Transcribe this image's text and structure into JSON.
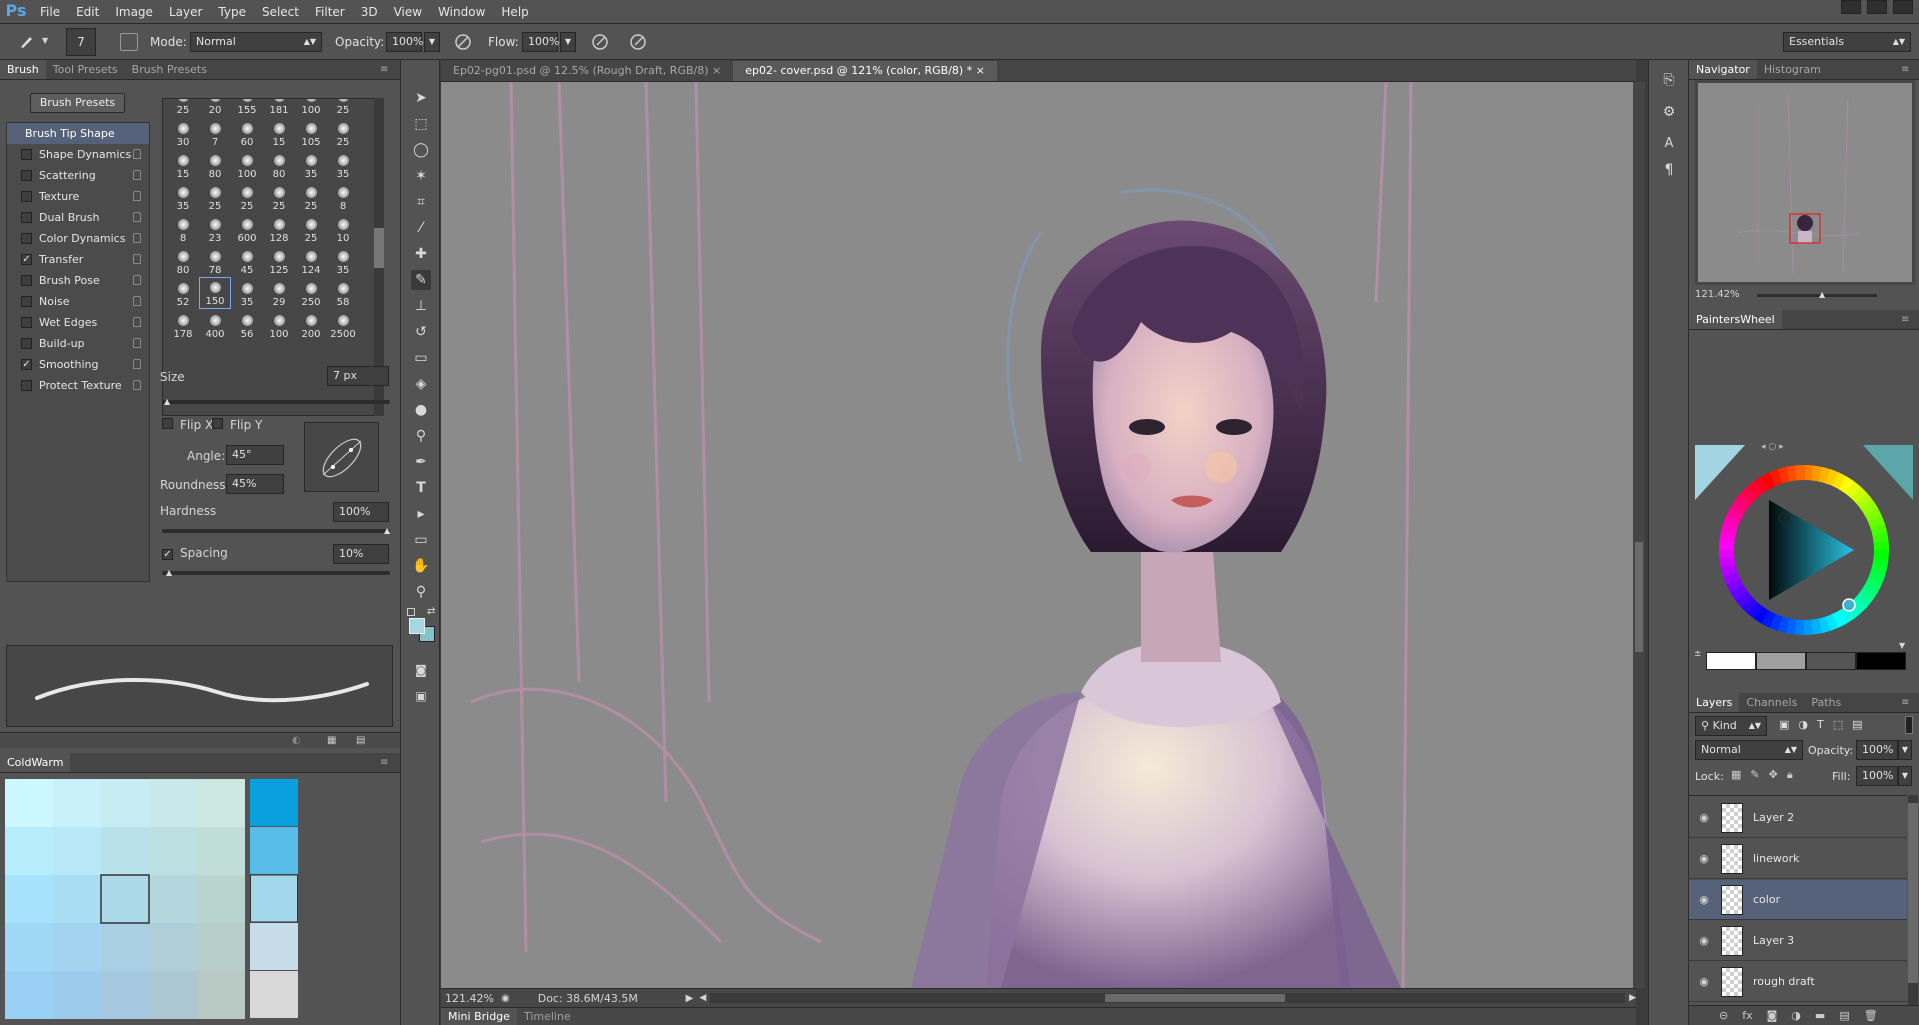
{
  "app": {
    "logo": "Ps"
  },
  "menu": [
    "File",
    "Edit",
    "Image",
    "Layer",
    "Type",
    "Select",
    "Filter",
    "3D",
    "View",
    "Window",
    "Help"
  ],
  "options": {
    "brush_size": "7",
    "mode_label": "Mode:",
    "mode_value": "Normal",
    "opacity_label": "Opacity:",
    "opacity_value": "100%",
    "flow_label": "Flow:",
    "flow_value": "100%",
    "workspace": "Essentials"
  },
  "brush_panel": {
    "tabs": [
      "Brush",
      "Tool Presets",
      "Brush Presets"
    ],
    "presets_button": "Brush Presets",
    "tip_shape": "Brush Tip Shape",
    "settings": [
      {
        "label": "Shape Dynamics",
        "checked": false
      },
      {
        "label": "Scattering",
        "checked": false
      },
      {
        "label": "Texture",
        "checked": false
      },
      {
        "label": "Dual Brush",
        "checked": false
      },
      {
        "label": "Color Dynamics",
        "checked": false
      },
      {
        "label": "Transfer",
        "checked": true
      },
      {
        "label": "Brush Pose",
        "checked": false
      },
      {
        "label": "Noise",
        "checked": false
      },
      {
        "label": "Wet Edges",
        "checked": false
      },
      {
        "label": "Build-up",
        "checked": false
      },
      {
        "label": "Smoothing",
        "checked": true
      },
      {
        "label": "Protect Texture",
        "checked": false
      }
    ],
    "brush_sizes": [
      "25",
      "20",
      "155",
      "181",
      "100",
      "25",
      "30",
      "7",
      "60",
      "15",
      "105",
      "25",
      "15",
      "80",
      "100",
      "80",
      "35",
      "35",
      "35",
      "25",
      "25",
      "25",
      "25",
      "8",
      "8",
      "23",
      "600",
      "128",
      "25",
      "10",
      "80",
      "78",
      "45",
      "125",
      "124",
      "35",
      "52",
      "150",
      "35",
      "29",
      "250",
      "58",
      "178",
      "400",
      "56",
      "100",
      "200",
      "2500"
    ],
    "size_label": "Size",
    "size_value": "7 px",
    "flipx": "Flip X",
    "flipy": "Flip Y",
    "angle_label": "Angle:",
    "angle_value": "45°",
    "roundness_label": "Roundness:",
    "roundness_value": "45%",
    "hardness_label": "Hardness",
    "hardness_value": "100%",
    "spacing_label": "Spacing",
    "spacing_value": "10%"
  },
  "coldwarm": {
    "title": "ColdWarm",
    "grid_colors": [
      [
        "#ccf7ff",
        "#c9f1fb",
        "#c8ecf4",
        "#c8e9ea",
        "#cce6e0"
      ],
      [
        "#b7ecfd",
        "#b8e7f7",
        "#b8e1ec",
        "#bcdfe2",
        "#c1ddd7"
      ],
      [
        "#a6e2fb",
        "#a9ddf4",
        "#acd9e8",
        "#b3d7dc",
        "#b9d4cf"
      ],
      [
        "#9fd8f7",
        "#a3d3ef",
        "#a8cfe3",
        "#afced7",
        "#b7cdca"
      ],
      [
        "#98cff2",
        "#9dcbeb",
        "#a4c8df",
        "#adc7d2",
        "#b8c8c2"
      ]
    ],
    "column_colors": [
      "#0aa0e0",
      "#58bde9",
      "#a2d7ec",
      "#c6dce6",
      "#d8d8d8"
    ]
  },
  "documents": {
    "tabs": [
      "Ep02-pg01.psd @ 12.5% (Rough Draft, RGB/8)",
      "ep02- cover.psd @ 121% (color, RGB/8) *"
    ],
    "zoom": "121.42%",
    "doc_info": "Doc: 38.6M/43.5M"
  },
  "bottom_tabs": [
    "Mini Bridge",
    "Timeline"
  ],
  "navigator": {
    "tabs": [
      "Navigator",
      "Histogram"
    ],
    "zoom": "121.42%"
  },
  "painterswheel": {
    "title": "PaintersWheel",
    "swatches": [
      "#ffffff",
      "#a0a0a0",
      "#555555",
      "#000000"
    ]
  },
  "layers": {
    "tabs": [
      "Layers",
      "Channels",
      "Paths"
    ],
    "kind": "Kind",
    "blend": "Normal",
    "opacity_label": "Opacity:",
    "opacity_value": "100%",
    "lock_label": "Lock:",
    "fill_label": "Fill:",
    "fill_value": "100%",
    "items": [
      {
        "name": "Layer 2",
        "selected": false
      },
      {
        "name": "linework",
        "selected": false
      },
      {
        "name": "color",
        "selected": true
      },
      {
        "name": "Layer 3",
        "selected": false
      },
      {
        "name": "rough draft",
        "selected": false
      }
    ]
  },
  "colors": {
    "accent": "#5ba4e6",
    "foreground": "#a6d7e0",
    "background": "#88c2cc"
  }
}
